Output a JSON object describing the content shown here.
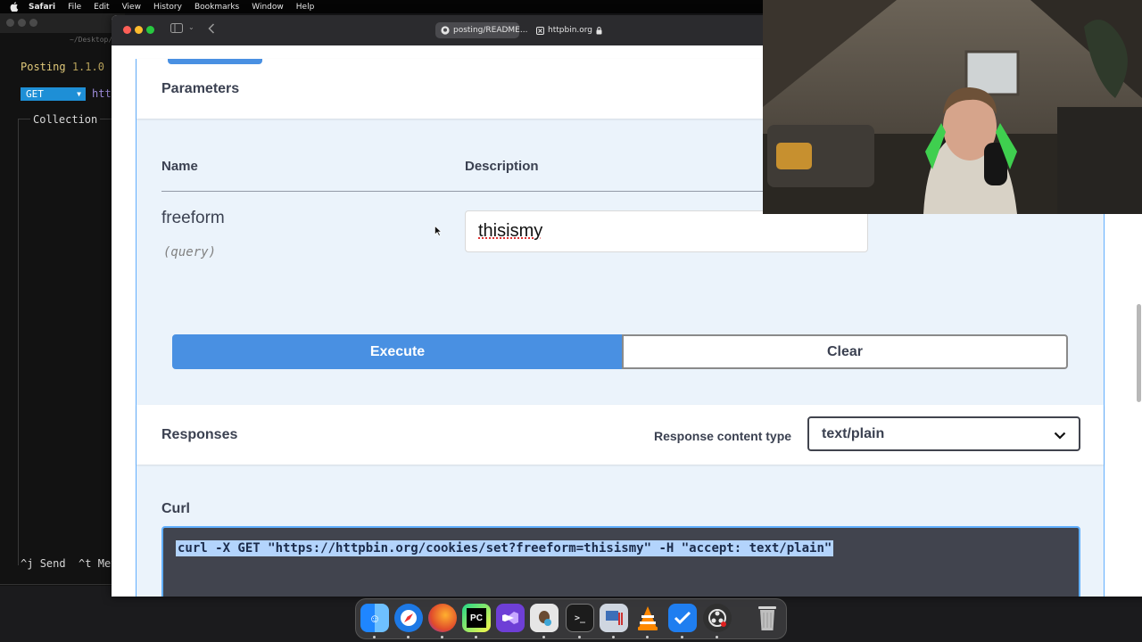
{
  "menubar": {
    "app": "Safari",
    "items": [
      "File",
      "Edit",
      "View",
      "History",
      "Bookmarks",
      "Window",
      "Help"
    ]
  },
  "terminal": {
    "path": "~/Desktop/",
    "app_name": "Posting",
    "version": "1.1.0",
    "method": "GET",
    "url_fragment": "htt",
    "collection_label": "Collection",
    "send_key": "^j",
    "send_label": "Send",
    "method_key": "^t",
    "method_label": "Met"
  },
  "browser": {
    "tabs": [
      {
        "label": "posting/README..."
      },
      {
        "label": "httpbin.org"
      }
    ]
  },
  "swagger": {
    "parameters_title": "Parameters",
    "col_name": "Name",
    "col_description": "Description",
    "param_name": "freeform",
    "param_in": "(query)",
    "param_value": "thisismy",
    "execute_label": "Execute",
    "clear_label": "Clear",
    "responses_title": "Responses",
    "response_content_type_label": "Response content type",
    "response_content_type_value": "text/plain",
    "curl_label": "Curl",
    "curl_command": "curl -X GET \"https://httpbin.org/cookies/set?freeform=thisismy\" -H \"accept: text/plain\""
  },
  "colors": {
    "accent_blue": "#4990e2",
    "border_blue": "#61affe",
    "text_dark": "#3b4151",
    "curl_bg": "#41444e"
  },
  "dock": {
    "icons": [
      "finder-icon",
      "safari-icon",
      "firefox-icon",
      "pycharm-icon",
      "visual-studio-icon",
      "preview-icon",
      "terminal-icon",
      "system-monitor-icon",
      "vlc-icon",
      "tasks-icon",
      "obs-icon",
      "trash-icon"
    ]
  }
}
